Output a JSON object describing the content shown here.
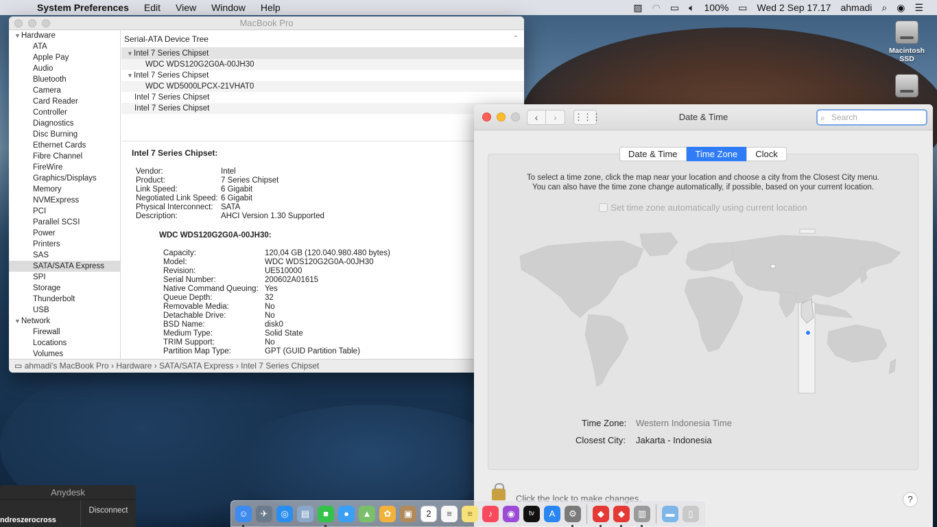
{
  "menubar": {
    "app_name": "System Preferences",
    "menus": [
      "Edit",
      "View",
      "Window",
      "Help"
    ],
    "battery": "100%",
    "clock": "Wed 2 Sep  17.17",
    "user": "ahmadi"
  },
  "desktop": {
    "disk1_label": "Macintosh SSD"
  },
  "sysinfo": {
    "window_title": "MacBook Pro",
    "sidebar": [
      {
        "label": "Hardware",
        "group": true
      },
      {
        "label": "ATA"
      },
      {
        "label": "Apple Pay"
      },
      {
        "label": "Audio"
      },
      {
        "label": "Bluetooth"
      },
      {
        "label": "Camera"
      },
      {
        "label": "Card Reader"
      },
      {
        "label": "Controller"
      },
      {
        "label": "Diagnostics"
      },
      {
        "label": "Disc Burning"
      },
      {
        "label": "Ethernet Cards"
      },
      {
        "label": "Fibre Channel"
      },
      {
        "label": "FireWire"
      },
      {
        "label": "Graphics/Displays"
      },
      {
        "label": "Memory"
      },
      {
        "label": "NVMExpress"
      },
      {
        "label": "PCI"
      },
      {
        "label": "Parallel SCSI"
      },
      {
        "label": "Power"
      },
      {
        "label": "Printers"
      },
      {
        "label": "SAS"
      },
      {
        "label": "SATA/SATA Express",
        "selected": true
      },
      {
        "label": "SPI"
      },
      {
        "label": "Storage"
      },
      {
        "label": "Thunderbolt"
      },
      {
        "label": "USB"
      },
      {
        "label": "Network",
        "group": true
      },
      {
        "label": "Firewall"
      },
      {
        "label": "Locations"
      },
      {
        "label": "Volumes"
      }
    ],
    "tree_header": "Serial-ATA Device Tree",
    "tree_rows": [
      {
        "label": "Intel 7 Series Chipset",
        "level": 0,
        "expanded": true
      },
      {
        "label": "WDC WDS120G2G0A-00JH30",
        "level": 1
      },
      {
        "label": "Intel 7 Series Chipset",
        "level": 0,
        "expanded": true
      },
      {
        "label": "WDC WD5000LPCX-21VHAT0",
        "level": 1
      },
      {
        "label": "Intel 7 Series Chipset",
        "level": 0
      },
      {
        "label": "Intel 7 Series Chipset",
        "level": 0
      }
    ],
    "detail_title": "Intel 7 Series Chipset:",
    "detail_rows": [
      {
        "k": "Vendor:",
        "v": "Intel"
      },
      {
        "k": "Product:",
        "v": "7 Series Chipset"
      },
      {
        "k": "Link Speed:",
        "v": "6 Gigabit"
      },
      {
        "k": "Negotiated Link Speed:",
        "v": "6 Gigabit"
      },
      {
        "k": "Physical Interconnect:",
        "v": "SATA"
      },
      {
        "k": "Description:",
        "v": "AHCI Version 1.30 Supported"
      }
    ],
    "drive_title": "WDC WDS120G2G0A-00JH30:",
    "drive_rows": [
      {
        "k": "Capacity:",
        "v": "120,04 GB (120.040.980.480 bytes)"
      },
      {
        "k": "Model:",
        "v": "WDC WDS120G2G0A-00JH30"
      },
      {
        "k": "Revision:",
        "v": "UE510000"
      },
      {
        "k": "Serial Number:",
        "v": "200602A01615"
      },
      {
        "k": "Native Command Queuing:",
        "v": "Yes"
      },
      {
        "k": "Queue Depth:",
        "v": "32"
      },
      {
        "k": "Removable Media:",
        "v": "No"
      },
      {
        "k": "Detachable Drive:",
        "v": "No"
      },
      {
        "k": "BSD Name:",
        "v": "disk0"
      },
      {
        "k": "Medium Type:",
        "v": "Solid State"
      },
      {
        "k": "TRIM Support:",
        "v": "No"
      },
      {
        "k": "Partition Map Type:",
        "v": "GPT (GUID Partition Table)"
      }
    ],
    "pathbar": "ahmadi's MacBook Pro  ›  Hardware  ›  SATA/SATA Express  ›  Intel 7 Series Chipset"
  },
  "datetime": {
    "title": "Date & Time",
    "search_placeholder": "Search",
    "tabs": [
      {
        "label": "Date & Time",
        "active": false
      },
      {
        "label": "Time Zone",
        "active": true
      },
      {
        "label": "Clock",
        "active": false
      }
    ],
    "instruction_line1": "To select a time zone, click the map near your location and choose a city from the Closest City menu.",
    "instruction_line2": "You can also have the time zone change automatically, if possible, based on your current location.",
    "auto_checkbox_label": "Set time zone automatically using current location",
    "auto_checkbox_checked": false,
    "time_zone_label": "Time Zone:",
    "time_zone_value": "Western Indonesia Time",
    "closest_city_label": "Closest City:",
    "closest_city_value": "Jakarta - Indonesia",
    "lock_text": "Click the lock to make changes.",
    "help_label": "?"
  },
  "anydesk": {
    "title": "Anydesk",
    "user": "ndreszerocross",
    "disconnect": "Disconnect"
  },
  "dock": {
    "items": [
      "finder-icon",
      "launchpad-icon",
      "safari-icon",
      "preview-icon",
      "facetime-icon",
      "messages-icon",
      "maps-icon",
      "photos-icon",
      "contacts-icon",
      "calendar-icon",
      "reminders-icon",
      "notes-icon",
      "music-icon",
      "podcasts-icon",
      "tv-icon",
      "app-store-icon",
      "system-preferences-icon",
      "anydesk-icon",
      "anydesk-alt-icon",
      "printer-icon",
      "folder-icon",
      "trash-icon"
    ],
    "calendar_day": "2"
  }
}
